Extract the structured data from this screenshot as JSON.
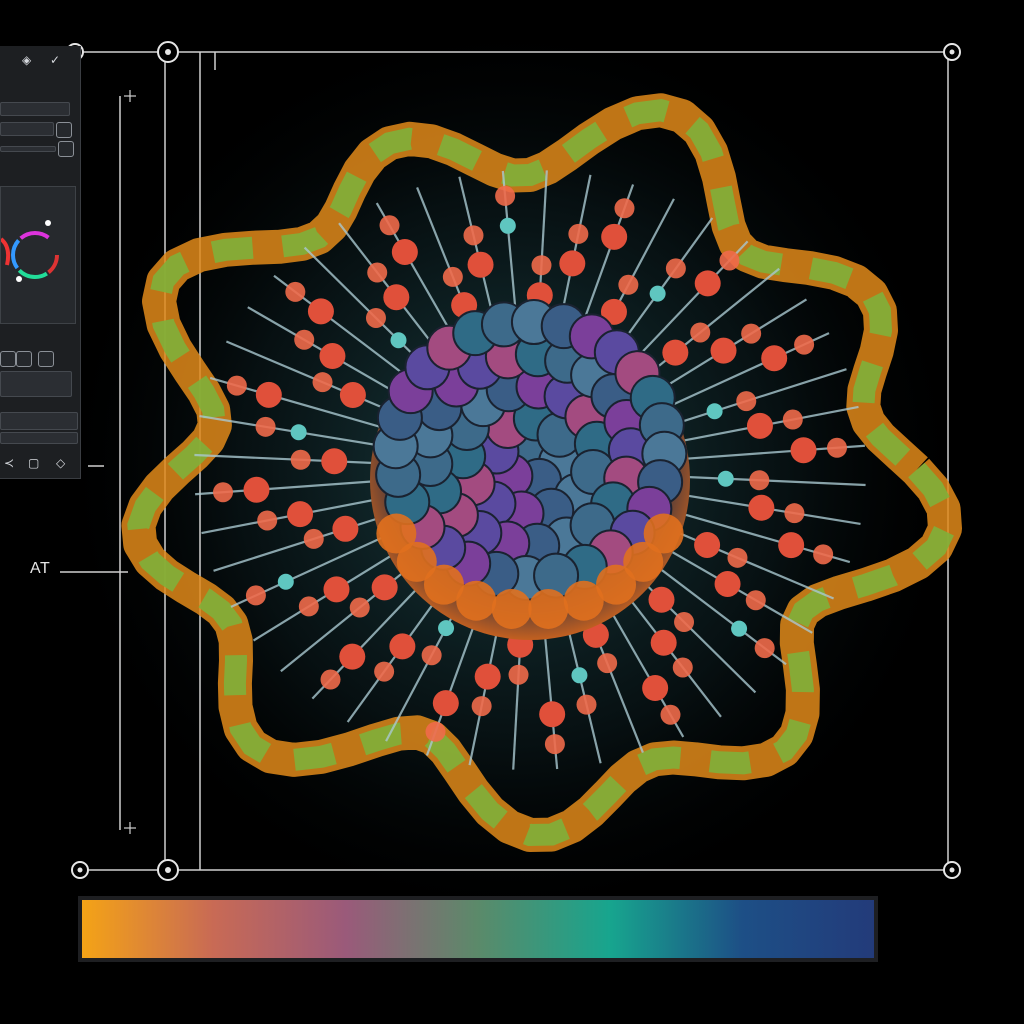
{
  "annotation": {
    "label": "AT"
  },
  "gradient": {
    "stops": [
      "#f4a316",
      "#c86a55",
      "#9a5a7a",
      "#5b8a6a",
      "#17a58e",
      "#1d4f86",
      "#233b7a"
    ]
  },
  "panel": {
    "buttons": [
      "visibility-icon",
      "checkmark-icon",
      "lock-icon",
      "reset-icon",
      "share-icon",
      "copy-icon",
      "fill-icon"
    ]
  },
  "colors": {
    "background": "#000000",
    "core_blue": "#3d6a8a",
    "core_purple": "#7b3f9a",
    "bead_red": "#e0503a",
    "bead_teal": "#5fc6c0",
    "tail_green": "#7fb03a",
    "tail_orange": "#e08a1a"
  }
}
